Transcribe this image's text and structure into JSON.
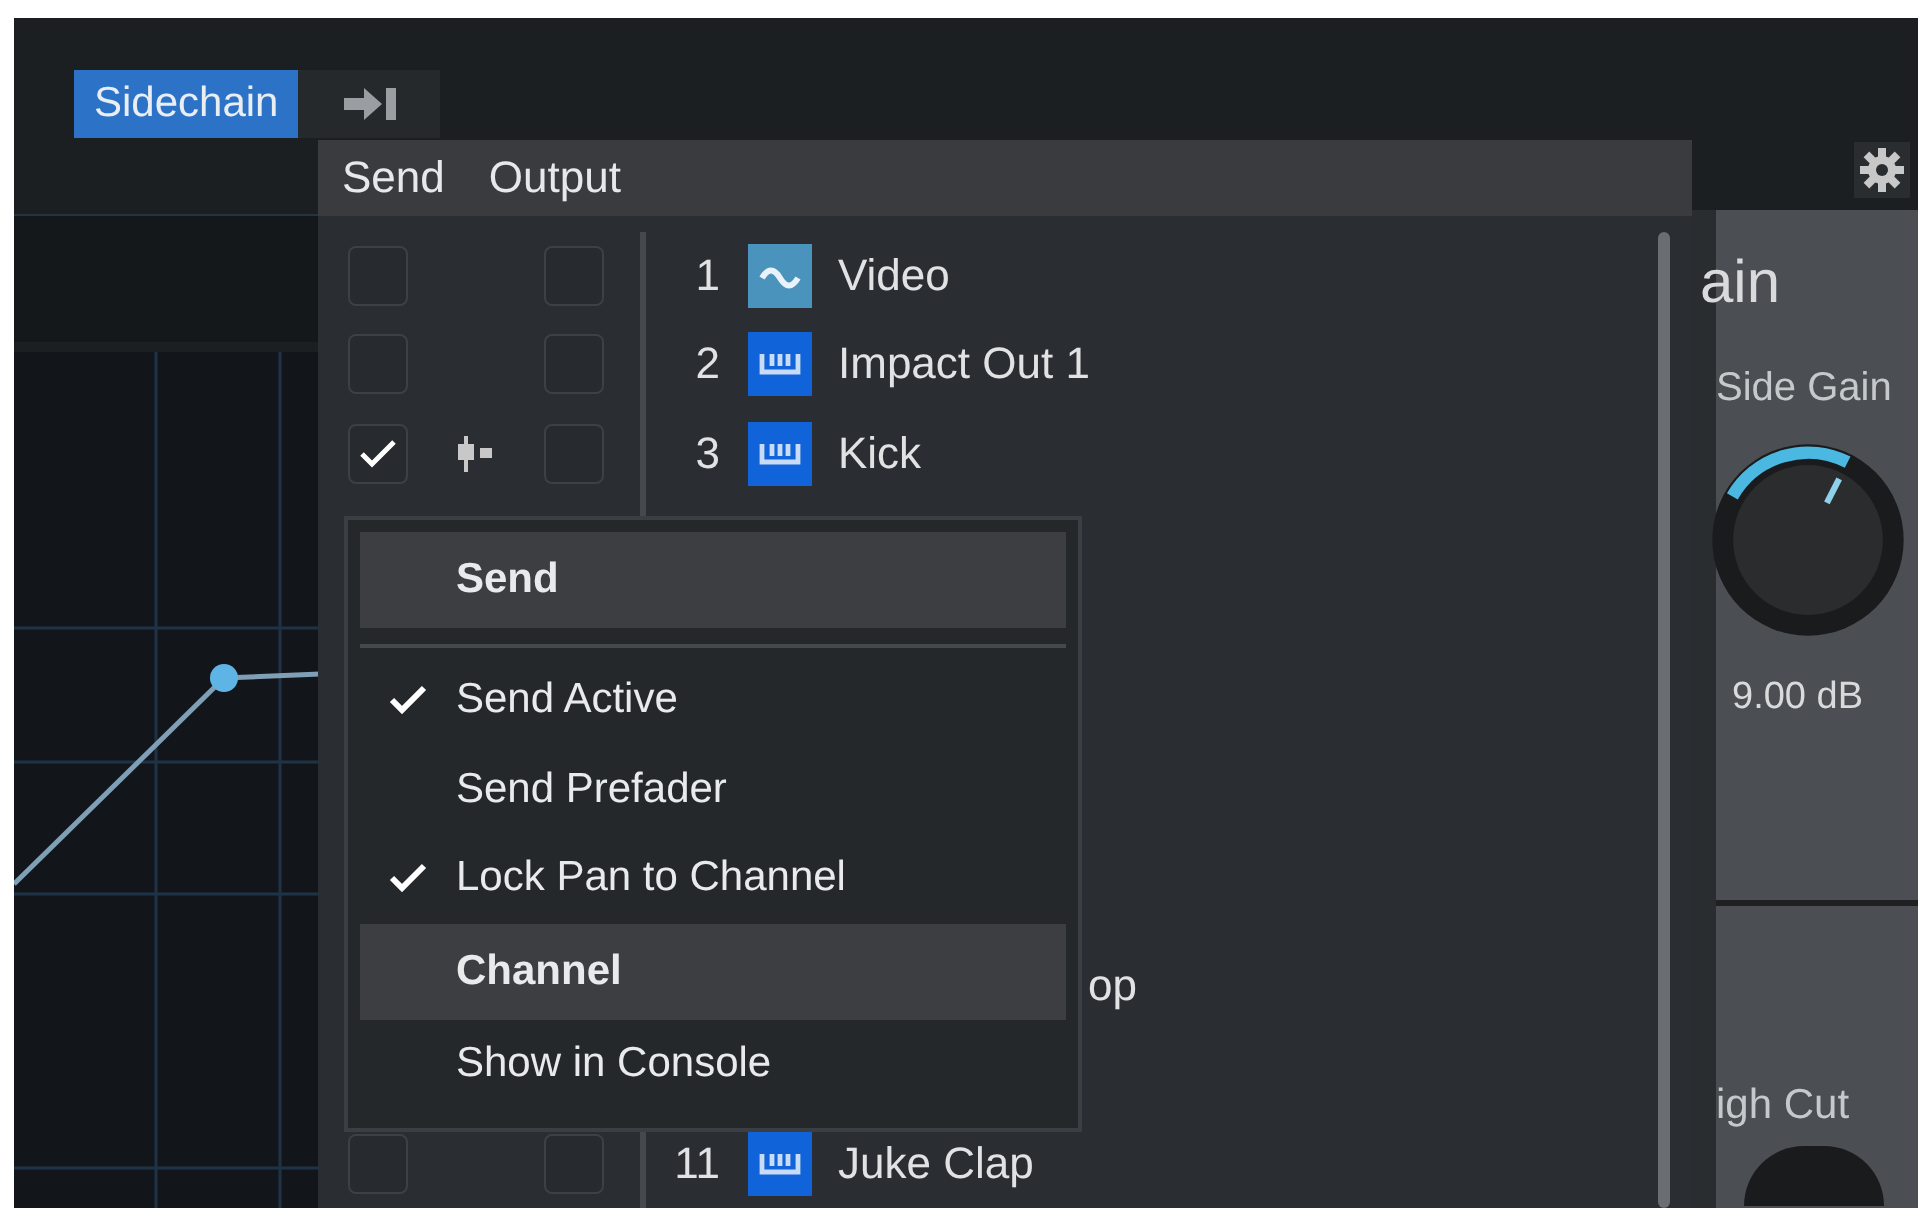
{
  "tabs": [
    {
      "label": "Sidechain",
      "kind": "text",
      "selected": true
    },
    {
      "kind": "icon",
      "selected": false
    }
  ],
  "popup": {
    "columns": [
      "Send",
      "Output"
    ],
    "rows": [
      {
        "kind": "video-track",
        "number": "1",
        "name": "Video",
        "send": false,
        "output": false,
        "pan_locked": false
      },
      {
        "kind": "instrument-track",
        "number": "2",
        "name": "Impact Out 1",
        "send": false,
        "output": false,
        "pan_locked": false
      },
      {
        "kind": "instrument-track",
        "number": "3",
        "name": "Kick",
        "send": true,
        "output": false,
        "pan_locked": true
      },
      {
        "kind": "partial",
        "name": "op"
      },
      {
        "kind": "instrument-track",
        "number": "11",
        "name": "Juke Clap",
        "send": false,
        "output": false,
        "pan_locked": false
      }
    ]
  },
  "context_menu": {
    "items": [
      {
        "kind": "header",
        "label": "Send"
      },
      {
        "kind": "separator"
      },
      {
        "kind": "option",
        "label": "Send Active",
        "checked": true
      },
      {
        "kind": "option",
        "label": "Send Prefader",
        "checked": false
      },
      {
        "kind": "option",
        "label": "Lock Pan to Channel",
        "checked": true
      },
      {
        "kind": "header",
        "label": "Channel"
      },
      {
        "kind": "option",
        "label": "Show in Console",
        "checked": false
      }
    ]
  },
  "side_panel": {
    "title": "ain",
    "knob": {
      "label": "Side Gain",
      "level": 0.6,
      "reading": "9.00 dB"
    },
    "second_label": "igh Cut"
  }
}
